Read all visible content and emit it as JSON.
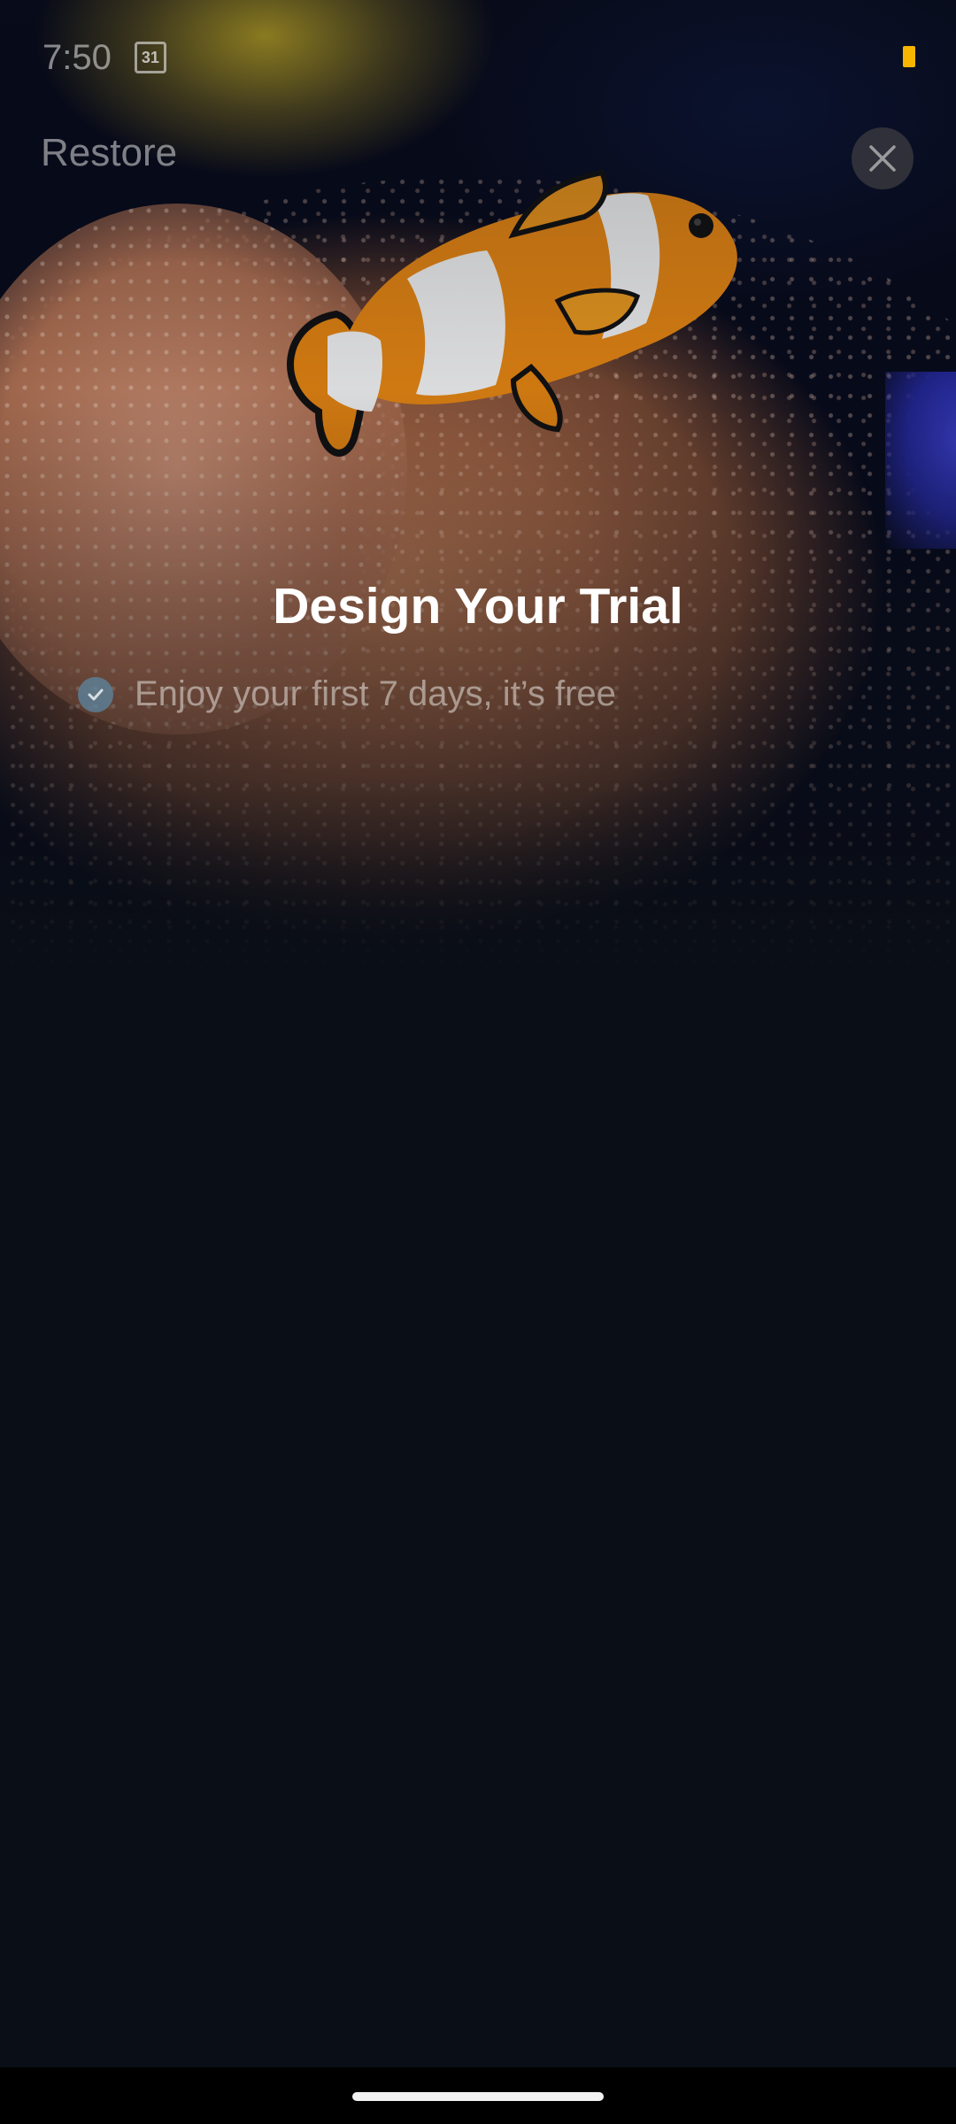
{
  "status_bar": {
    "time": "7:50",
    "calendar_day": "31",
    "battery_color": "#f7b500"
  },
  "header": {
    "restore_label": "Restore",
    "close_icon": "close-icon"
  },
  "hero": {
    "image": "clownfish-on-anemone"
  },
  "content": {
    "title": "Design Your Trial",
    "benefits": [
      {
        "icon": "check-circle-icon",
        "text": "Enjoy your first 7 days, it’s free"
      }
    ]
  },
  "colors": {
    "background": "#0a0e16",
    "title_text": "#ffffff",
    "check_accent": "#5c8caa"
  }
}
